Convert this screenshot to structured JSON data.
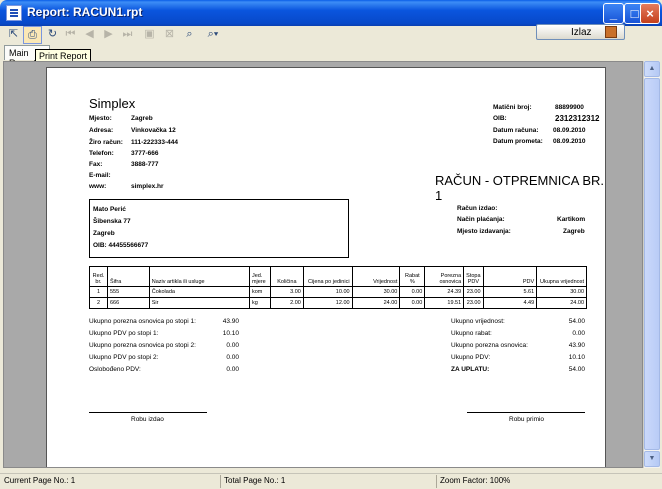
{
  "window": {
    "title": "Report: RACUN1.rpt"
  },
  "toolbar": {
    "exit_label": "Izlaz",
    "tooltip": "Print Report"
  },
  "tabs": [
    {
      "label": "Main Report"
    }
  ],
  "report": {
    "company": "Simplex",
    "seller": [
      {
        "label": "Mjesto:",
        "value": "Zagreb"
      },
      {
        "label": "Adresa:",
        "value": "Vinkovačka 12"
      },
      {
        "label": "Žiro račun:",
        "value": "111-222333-444"
      },
      {
        "label": "Telefon:",
        "value": "3777-666"
      },
      {
        "label": "Fax:",
        "value": "3888-777"
      },
      {
        "label": "E-mail:",
        "value": ""
      },
      {
        "label": "www:",
        "value": "simplex.hr"
      }
    ],
    "meta": [
      {
        "label": "Matični broj:",
        "value": "88899900"
      },
      {
        "label": "OIB:",
        "value": "2312312312"
      },
      {
        "label": "Datum računa:",
        "value": "08.09.2010"
      },
      {
        "label": "Datum prometa:",
        "value": "08.09.2010"
      }
    ],
    "doc_title": "RAČUN - OTPREMNICA BR. 1",
    "buyer": {
      "name": "Mato Perić",
      "street": "Šibenska 77",
      "city": "Zagreb",
      "oib": "OIB: 44455566677"
    },
    "issue": [
      {
        "label": "Račun izdao:",
        "value": ""
      },
      {
        "label": "Način plaćanja:",
        "value": "Kartikom"
      },
      {
        "label": "Mjesto izdavanja:",
        "value": "Zagreb"
      }
    ],
    "table": {
      "headers": [
        "Red. br.",
        "Šifra",
        "Naziv artikla ili usluge",
        "Jed. mjere",
        "Količina",
        "Cijena po jedinici",
        "Vrijednost",
        "Rabat %",
        "Porezna osnovica",
        "Stopa PDV",
        "PDV",
        "Ukupna vrijednost"
      ],
      "rows": [
        [
          "1",
          "555",
          "Čokolada",
          "kom",
          "3.00",
          "10.00",
          "30.00",
          "0.00",
          "24.39",
          "23.00",
          "5.61",
          "30.00"
        ],
        [
          "2",
          "666",
          "Sir",
          "kg",
          "2.00",
          "12.00",
          "24.00",
          "0.00",
          "19.51",
          "23.00",
          "4.49",
          "24.00"
        ]
      ]
    },
    "left_totals": [
      {
        "label": "Ukupno porezna osnovica po stopi 1:",
        "value": "43.90"
      },
      {
        "label": "Ukupno PDV po stopi 1:",
        "value": "10.10"
      },
      {
        "label": "Ukupno porezna osnovica po stopi 2:",
        "value": "0.00"
      },
      {
        "label": "Ukupno PDV po stopi 2:",
        "value": "0.00"
      },
      {
        "label": "Oslobođeno PDV:",
        "value": "0.00"
      }
    ],
    "right_totals": [
      {
        "label": "Ukupno vrijednost:",
        "value": "54.00"
      },
      {
        "label": "Ukupno rabat:",
        "value": "0.00"
      },
      {
        "label": "Ukupno porezna osnovica:",
        "value": "43.90"
      },
      {
        "label": "Ukupno PDV:",
        "value": "10.10"
      },
      {
        "label": "ZA UPLATU:",
        "value": "54.00"
      }
    ],
    "sign_issued": "Robu izdao",
    "sign_received": "Robu primio"
  },
  "status": {
    "current_page": "Current Page No.: 1",
    "total_page": "Total Page No.: 1",
    "zoom": "Zoom Factor: 100%"
  }
}
